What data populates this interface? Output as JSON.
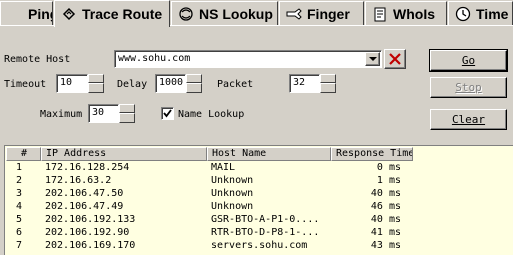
{
  "tabs": [
    {
      "label": "Ping",
      "icon": "ping-icon"
    },
    {
      "label": "Trace Route",
      "icon": "trace-route-icon"
    },
    {
      "label": "NS Lookup",
      "icon": "ns-lookup-icon"
    },
    {
      "label": "Finger",
      "icon": "finger-icon"
    },
    {
      "label": "WhoIs",
      "icon": "whois-icon"
    },
    {
      "label": "Time",
      "icon": "clock-icon"
    }
  ],
  "active_tab": "Trace Route",
  "form": {
    "remote_host_label": "Remote Host",
    "remote_host_value": "www.sohu.com",
    "timeout_label": "Timeout",
    "timeout_value": "10",
    "delay_label": "Delay",
    "delay_value": "1000",
    "packet_label": "Packet",
    "packet_value": "32",
    "maximum_label": "Maximum",
    "maximum_value": "30",
    "name_lookup_label": "Name Lookup",
    "name_lookup_checked": true
  },
  "buttons": {
    "go": "Go",
    "stop": "Stop",
    "clear": "Clear"
  },
  "columns": [
    "#",
    "IP Address",
    "Host Name",
    "Response Time"
  ],
  "rows": [
    {
      "num": "1",
      "ip": "172.16.128.254",
      "host": "MAIL",
      "time": "0 ms"
    },
    {
      "num": "2",
      "ip": "172.16.63.2",
      "host": "Unknown",
      "time": "1 ms"
    },
    {
      "num": "3",
      "ip": "202.106.47.50",
      "host": "Unknown",
      "time": "40 ms"
    },
    {
      "num": "4",
      "ip": "202.106.47.49",
      "host": "Unknown",
      "time": "46 ms"
    },
    {
      "num": "5",
      "ip": "202.106.192.133",
      "host": "GSR-BTO-A-P1-0....",
      "time": "40 ms"
    },
    {
      "num": "6",
      "ip": "202.106.192.90",
      "host": "RTR-BTO-D-P8-1-...",
      "time": "41 ms"
    },
    {
      "num": "7",
      "ip": "202.106.169.170",
      "host": "servers.sohu.com",
      "time": "43 ms"
    }
  ]
}
